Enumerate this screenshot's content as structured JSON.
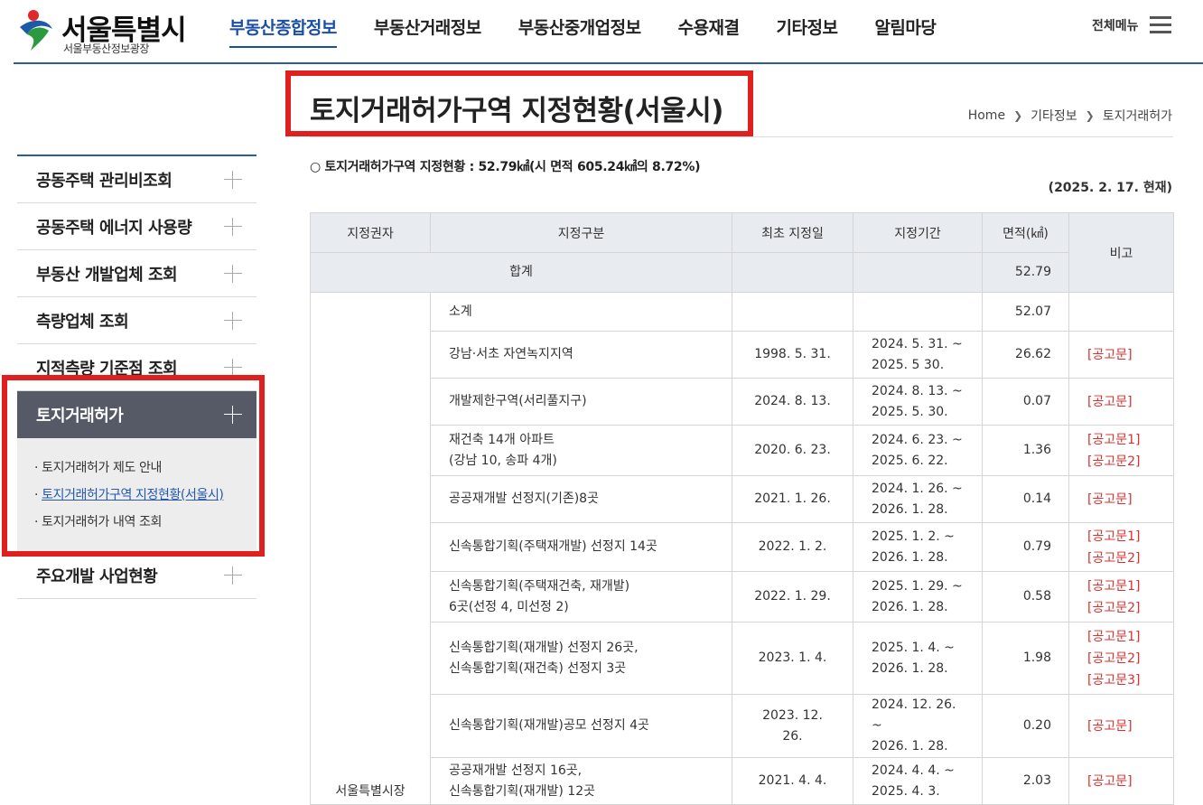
{
  "header": {
    "logo_title": "서울특별시",
    "logo_sub": "서울부동산정보광장",
    "nav": [
      "부동산종합정보",
      "부동산거래정보",
      "부동산중개업정보",
      "수용재결",
      "기타정보",
      "알림마당"
    ],
    "active_nav": 0,
    "all_menu": "전체메뉴"
  },
  "sidebar": {
    "items_before": [
      "공동주택 관리비조회",
      "공동주택 에너지 사용량",
      "부동산 개발업체 조회",
      "측량업체 조회",
      "지적측량 기준점 조회"
    ],
    "active_label": "토지거래허가",
    "sub_items": [
      "토지거래허가 제도 안내",
      "토지거래허가구역 지정현황(서울시)",
      "토지거래허가 내역 조회"
    ],
    "items_after": [
      "주요개발 사업현황"
    ]
  },
  "content": {
    "title": "토지거래허가구역 지정현황(서울시)",
    "breadcrumb": [
      "Home",
      "기타정보",
      "토지거래허가"
    ],
    "summary": "○ 토지거래허가구역 지정현황 : 52.79㎢(시 면적 605.24㎢의 8.72%)",
    "as_of": "(2025. 2. 17. 현재)"
  },
  "table": {
    "headers": [
      "지정권자",
      "지정구분",
      "최초 지정일",
      "지정기간",
      "면적(㎢)",
      "비고"
    ],
    "total": {
      "label": "합계",
      "area": "52.79"
    },
    "authority": "서울특별시장",
    "rows": [
      {
        "type": "소계",
        "date": "",
        "period": [],
        "area": "52.07",
        "notes": []
      },
      {
        "type": "강남·서초 자연녹지지역",
        "date": "1998. 5. 31.",
        "period": [
          "2024. 5. 31. ~",
          "2025. 5 30."
        ],
        "area": "26.62",
        "notes": [
          "[공고문]"
        ]
      },
      {
        "type": "개발제한구역(서리풀지구)",
        "date": "2024. 8. 13.",
        "period": [
          "2024. 8. 13. ~",
          "2025. 5. 30."
        ],
        "area": "0.07",
        "notes": [
          "[공고문]"
        ]
      },
      {
        "type": "재건축 14개 아파트\n(강남 10, 송파 4개)",
        "date": "2020. 6. 23.",
        "period": [
          "2024. 6. 23. ~",
          "2025. 6. 22."
        ],
        "area": "1.36",
        "notes": [
          "[공고문1]",
          "[공고문2]"
        ]
      },
      {
        "type": "공공재개발 선정지(기존)8곳",
        "date": "2021. 1. 26.",
        "period": [
          "2024. 1. 26. ~",
          "2026. 1. 28."
        ],
        "area": "0.14",
        "notes": [
          "[공고문]"
        ]
      },
      {
        "type": "신속통합기획(주택재개발) 선정지 14곳",
        "date": "2022. 1. 2.",
        "period": [
          "2025. 1. 2. ~",
          "2026. 1. 28."
        ],
        "area": "0.79",
        "notes": [
          "[공고문1]",
          "[공고문2]"
        ]
      },
      {
        "type": "신속통합기획(주택재건축, 재개발)\n6곳(선정 4, 미선정 2)",
        "date": "2022. 1. 29.",
        "period": [
          "2025. 1. 29. ~",
          "2026. 1. 28."
        ],
        "area": "0.58",
        "notes": [
          "[공고문1]",
          "[공고문2]"
        ]
      },
      {
        "type": "신속통합기획(재개발) 선정지 26곳,\n신속통합기획(재건축) 선정지 3곳",
        "date": "2023. 1. 4.",
        "period": [
          "2025. 1. 4. ~",
          "2026. 1. 28."
        ],
        "area": "1.98",
        "notes": [
          "[공고문1]",
          "[공고문2]",
          "[공고문3]"
        ]
      },
      {
        "type": "신속통합기획(재개발)공모 선정지 4곳",
        "date": "2023. 12. 26.",
        "period": [
          "2024. 12. 26. ~",
          "2026. 1. 28."
        ],
        "area": "0.20",
        "notes": [
          "[공고문]"
        ]
      },
      {
        "type": "공공재개발 선정지 16곳,\n신속통합기획(재개발) 12곳",
        "date": "2021. 4. 4.",
        "period": [
          "2024. 4. 4. ~",
          "2025. 4. 3."
        ],
        "area": "2.03",
        "notes": [
          "[공고문]"
        ]
      }
    ]
  },
  "colors": {
    "accent": "#1a4fa3",
    "highlight_box": "#e01f1f",
    "link_red": "#d9312f",
    "sidebar_active": "#555a66"
  }
}
